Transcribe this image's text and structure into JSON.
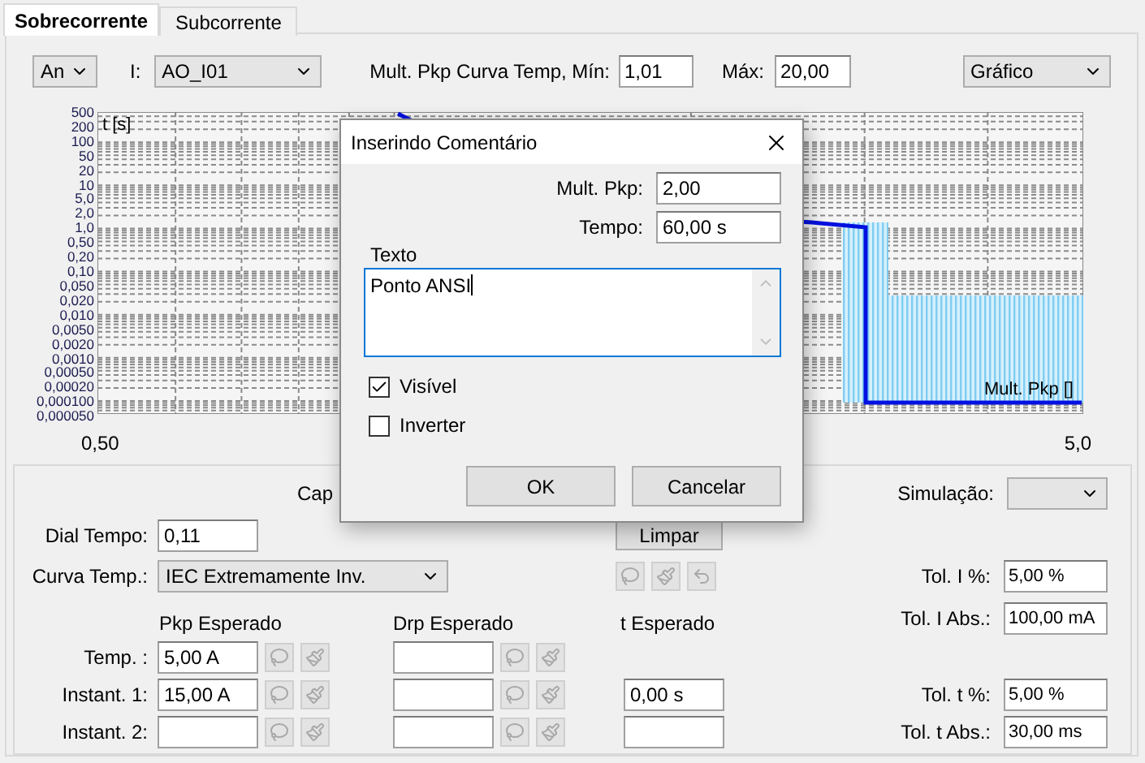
{
  "tabs": [
    {
      "label": "Sobrecorrente",
      "selected": true
    },
    {
      "label": "Subcorrente",
      "selected": false
    }
  ],
  "top_bar": {
    "phase": "An",
    "current_label": "I:",
    "current": "AO_I01",
    "mult_label": "Mult. Pkp Curva Temp, Mín:",
    "mult_min": "1,01",
    "max_label": "Máx:",
    "mult_max": "20,00",
    "view": "Gráfico"
  },
  "chart": {
    "y_label": "t [s]",
    "x_label": "Mult. Pkp []",
    "y_tick_labels": [
      "500",
      "200",
      "100",
      "50",
      "20",
      "10",
      "5,0",
      "2,0",
      "1,0",
      "0,50",
      "0,20",
      "0,10",
      "0,050",
      "0,020",
      "0,010",
      "0,0050",
      "0,0020",
      "0,0010",
      "0,00050",
      "0,00020",
      "0,000100",
      "0,000050"
    ],
    "x_tick_labels": [
      "0,50",
      "5,0"
    ]
  },
  "dialog": {
    "title": "Inserindo Comentário",
    "fields": [
      {
        "label": "Mult. Pkp:",
        "value": "2,00"
      },
      {
        "label": "Tempo:",
        "value": "60,00 s"
      }
    ],
    "text_label": "Texto",
    "text_value": "Ponto ANSI",
    "checkboxes": [
      {
        "label": "Visível",
        "checked": true
      },
      {
        "label": "Inverter",
        "checked": false
      }
    ],
    "buttons": [
      "OK",
      "Cancelar"
    ]
  },
  "settings": {
    "cap_label": "Cap",
    "dial_label": "Dial Tempo:",
    "dial_value": "0,11",
    "curve_label": "Curva Temp.:",
    "curve_value": "IEC Extremamente Inv.",
    "clear_button": "Limpar",
    "simulation_label": "Simulação:",
    "headers": [
      "Pkp Esperado",
      "Drp Esperado",
      "t Esperado"
    ],
    "rows": [
      {
        "label": "Temp. :",
        "pkp": "5,00 A",
        "kind": "no_t"
      },
      {
        "label": "Instant. 1:",
        "pkp": "15,00 A",
        "t": "0,00 s",
        "kind": "with_t"
      },
      {
        "label": "Instant. 2:",
        "kind": "with_t"
      }
    ],
    "tolerances": [
      {
        "label": "Tol. I %:",
        "value": "5,00 %"
      },
      {
        "label": "Tol. I Abs.:",
        "value": "100,00 mA"
      },
      {
        "label": "Tol. t %:",
        "value": "5,00 %"
      },
      {
        "label": "Tol. t Abs.:",
        "value": "30,00 ms"
      }
    ]
  }
}
